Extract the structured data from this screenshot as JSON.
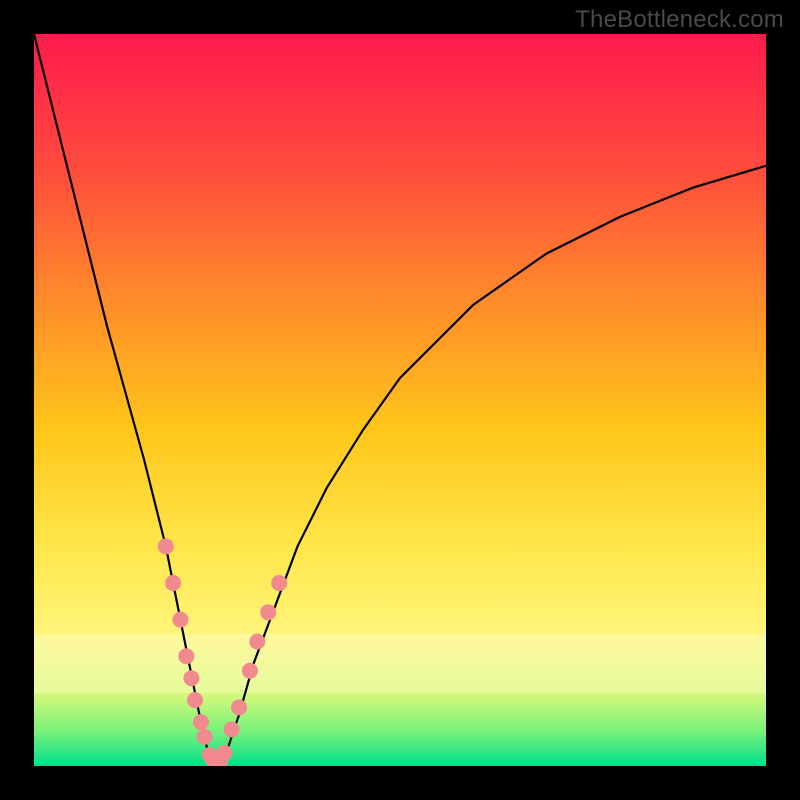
{
  "attribution": "TheBottleneck.com",
  "colors": {
    "frame": "#000000",
    "gradient_top": "#ff1a4d",
    "gradient_bottom": "#00e08a",
    "curve": "#000000",
    "dots": "#f18a8f"
  },
  "chart_data": {
    "type": "line",
    "title": "",
    "xlabel": "",
    "ylabel": "",
    "xlim": [
      0,
      100
    ],
    "ylim": [
      0,
      100
    ],
    "grid": false,
    "legend": false,
    "series": [
      {
        "name": "bottleneck-curve",
        "x": [
          0,
          5,
          10,
          15,
          18,
          20,
          22,
          23,
          24,
          25,
          26,
          28,
          30,
          33,
          36,
          40,
          45,
          50,
          55,
          60,
          70,
          80,
          90,
          100
        ],
        "y": [
          100,
          80,
          60,
          42,
          30,
          20,
          10,
          5,
          1,
          0,
          1,
          7,
          14,
          22,
          30,
          38,
          46,
          53,
          58,
          63,
          70,
          75,
          79,
          82
        ]
      }
    ],
    "highlight_points": {
      "name": "sample-dots",
      "x": [
        18,
        19,
        20,
        20.8,
        21.5,
        22,
        22.8,
        23.3,
        24,
        24.5,
        25,
        25.5,
        26,
        27,
        28,
        29.5,
        30.5,
        32,
        33.5
      ],
      "y": [
        30,
        25,
        20,
        15,
        12,
        9,
        6,
        4,
        1.5,
        0.8,
        0.3,
        0.8,
        1.8,
        5,
        8,
        13,
        17,
        21,
        25
      ]
    },
    "pale_bands_y": [
      {
        "from": 10,
        "to": 18
      }
    ]
  }
}
